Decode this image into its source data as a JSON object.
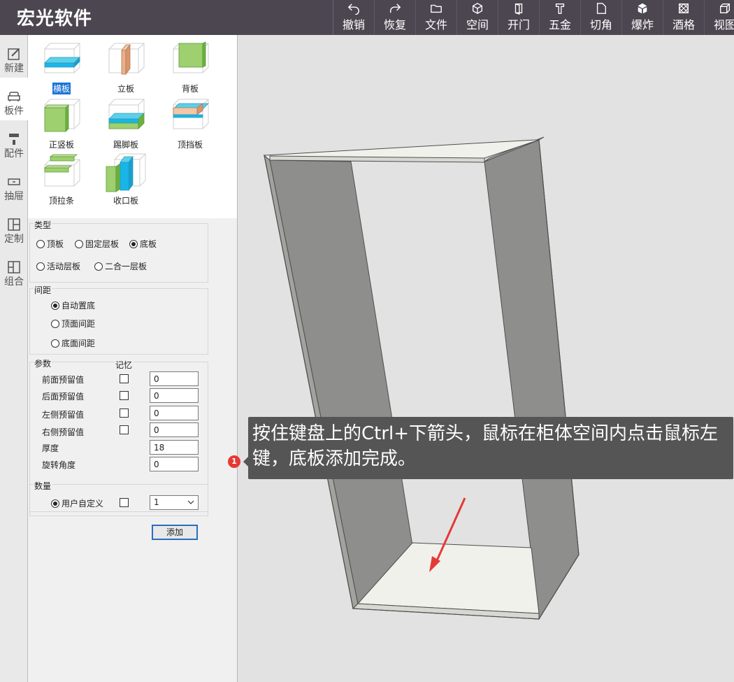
{
  "app": {
    "title": "宏光软件"
  },
  "toolbar": [
    {
      "label": "撤销",
      "icon": "undo-icon"
    },
    {
      "label": "恢复",
      "icon": "redo-icon"
    },
    {
      "label": "文件",
      "icon": "folder-icon"
    },
    {
      "label": "空间",
      "icon": "cube-icon"
    },
    {
      "label": "开门",
      "icon": "door-icon"
    },
    {
      "label": "五金",
      "icon": "hardware-icon"
    },
    {
      "label": "切角",
      "icon": "cut-corner-icon"
    },
    {
      "label": "爆炸",
      "icon": "explode-icon"
    },
    {
      "label": "酒格",
      "icon": "wine-rack-icon"
    },
    {
      "label": "视图",
      "icon": "view-icon"
    }
  ],
  "nav": [
    {
      "label": "新建",
      "icon": "edit-icon"
    },
    {
      "label": "板件",
      "icon": "sofa-icon",
      "active": true
    },
    {
      "label": "配件",
      "icon": "paint-roller-icon"
    },
    {
      "label": "抽屉",
      "icon": "drawer-icon"
    },
    {
      "label": "定制",
      "icon": "layout-icon"
    },
    {
      "label": "组合",
      "icon": "combine-icon"
    }
  ],
  "boards": [
    {
      "label": "横板",
      "selected": true
    },
    {
      "label": "立板"
    },
    {
      "label": "背板"
    },
    {
      "label": "正竖板"
    },
    {
      "label": "踢脚板"
    },
    {
      "label": "顶挡板"
    },
    {
      "label": "顶拉条"
    },
    {
      "label": "收口板"
    }
  ],
  "type_group": {
    "title": "类型",
    "options": [
      {
        "label": "顶板",
        "checked": false
      },
      {
        "label": "固定层板",
        "checked": false
      },
      {
        "label": "底板",
        "checked": true
      },
      {
        "label": "活动层板",
        "checked": false
      },
      {
        "label": "二合一层板",
        "checked": false
      }
    ]
  },
  "spacing_group": {
    "title": "间距",
    "options": [
      {
        "label": "自动置底",
        "checked": true
      },
      {
        "label": "顶面间距",
        "checked": false
      },
      {
        "label": "底面间距",
        "checked": false
      }
    ]
  },
  "params_group": {
    "title": "参数",
    "memory_label": "记忆",
    "rows": [
      {
        "label": "前面预留值",
        "value": "0",
        "has_checkbox": true
      },
      {
        "label": "后面预留值",
        "value": "0",
        "has_checkbox": true
      },
      {
        "label": "左侧预留值",
        "value": "0",
        "has_checkbox": true
      },
      {
        "label": "右侧预留值",
        "value": "0",
        "has_checkbox": true
      },
      {
        "label": "厚度",
        "value": "18",
        "has_checkbox": false
      },
      {
        "label": "旋转角度",
        "value": "0",
        "has_checkbox": false
      }
    ]
  },
  "quantity_group": {
    "title": "数量",
    "option_label": "用户自定义",
    "option_checked": true,
    "value": "1"
  },
  "add_button": {
    "label": "添加"
  },
  "tooltip": {
    "text": "按住键盘上的Ctrl+下箭头，鼠标在柜体空间内点击鼠标左键，底板添加完成。",
    "step": "1"
  },
  "colors": {
    "topbar": "#4b4650",
    "tooltip": "#555555",
    "panel_side": "#8e8e8c",
    "panel_top": "#f1f1ec",
    "arrow": "#e53935",
    "selected": "#1c74d6"
  }
}
